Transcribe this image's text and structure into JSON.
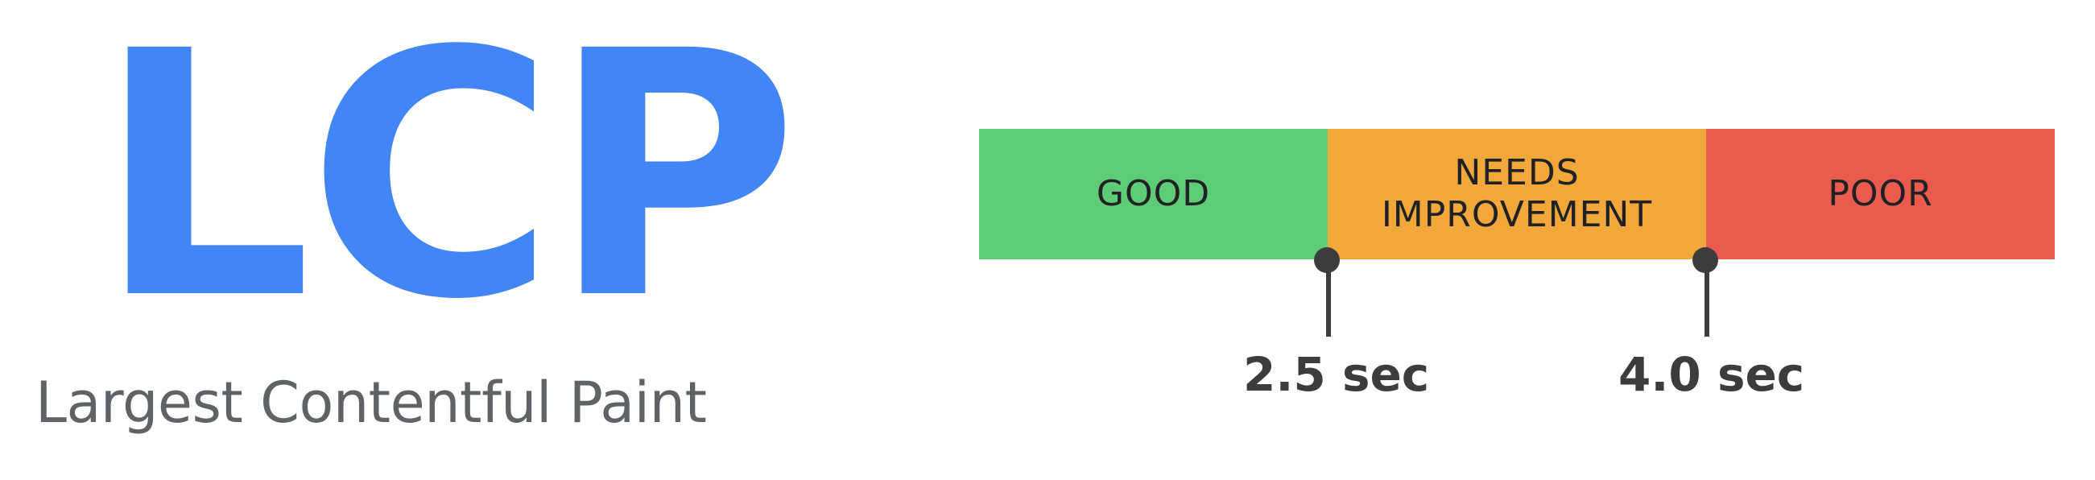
{
  "metric": {
    "acronym": "LCP",
    "name": "Largest Contentful Paint",
    "acronym_color": "#4285f4",
    "name_color": "#5f6368"
  },
  "scale": {
    "segments": [
      {
        "label": "GOOD",
        "color": "#5ecb76"
      },
      {
        "label": "NEEDS\nIMPROVEMENT",
        "color": "#f2a73b"
      },
      {
        "label": "POOR",
        "color": "#eb5b4d"
      }
    ],
    "thresholds": [
      {
        "label": "2.5 sec",
        "value": 2.5,
        "unit": "sec"
      },
      {
        "label": "4.0 sec",
        "value": 4.0,
        "unit": "sec"
      }
    ],
    "marker_color": "#3c3c3c"
  }
}
